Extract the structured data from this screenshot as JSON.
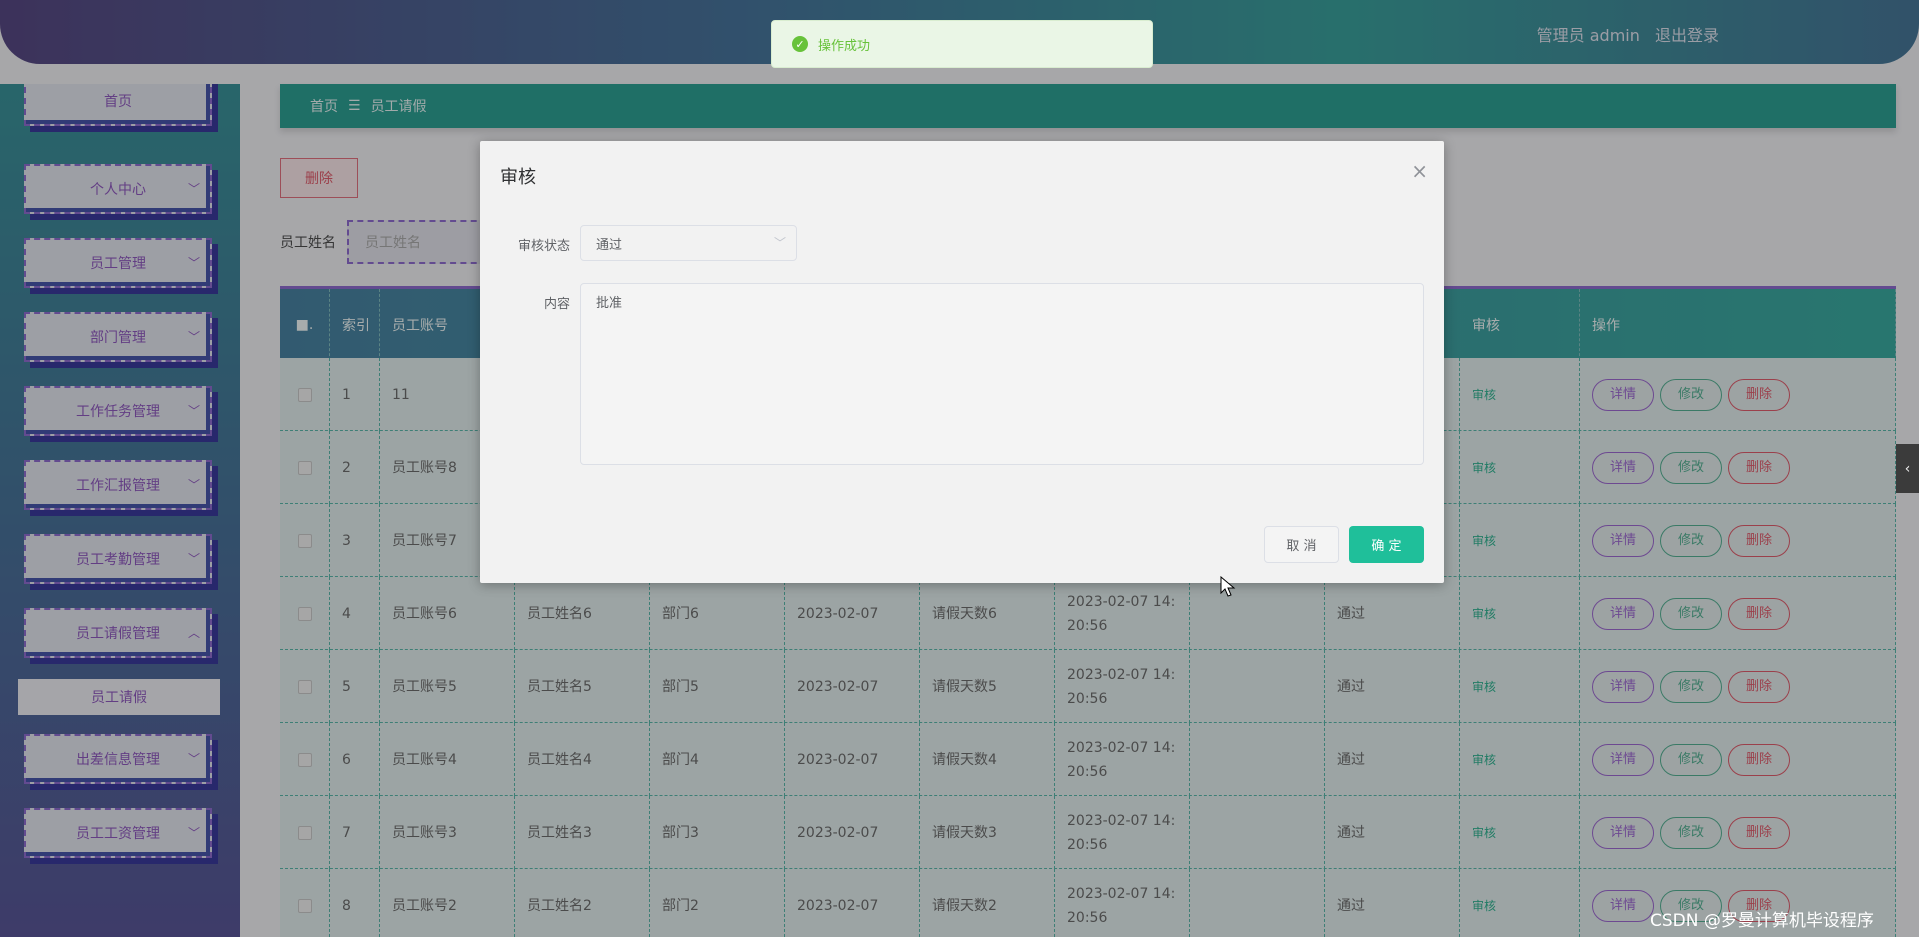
{
  "header": {
    "user_label": "管理员 admin",
    "logout": "退出登录"
  },
  "toast": {
    "message": "操作成功"
  },
  "sidebar": {
    "items": [
      {
        "label": "首页"
      },
      {
        "label": "个人中心"
      },
      {
        "label": "员工管理"
      },
      {
        "label": "部门管理"
      },
      {
        "label": "工作任务管理"
      },
      {
        "label": "工作汇报管理"
      },
      {
        "label": "员工考勤管理"
      },
      {
        "label": "员工请假管理"
      },
      {
        "label": "出差信息管理"
      },
      {
        "label": "员工工资管理"
      }
    ],
    "sub_item": "员工请假"
  },
  "breadcrumb": {
    "home": "首页",
    "separator": "☰",
    "current": "员工请假"
  },
  "toolbar": {
    "delete_label": "删除",
    "search_label": "员工姓名",
    "search_placeholder": "员工姓名"
  },
  "table": {
    "headers": {
      "select": "■.",
      "index": "索引",
      "account": "员工账号",
      "audit": "审核",
      "actions": "操作"
    },
    "rows": [
      {
        "idx": "1",
        "account": "11",
        "name": "",
        "dept": "",
        "date": "",
        "days": "",
        "time": "",
        "status": ""
      },
      {
        "idx": "2",
        "account": "员工账号8",
        "name": "",
        "dept": "",
        "date": "",
        "days": "",
        "time": "",
        "status": ""
      },
      {
        "idx": "3",
        "account": "员工账号7",
        "name": "",
        "dept": "",
        "date": "",
        "days": "",
        "time": "",
        "status": ""
      },
      {
        "idx": "4",
        "account": "员工账号6",
        "name": "员工姓名6",
        "dept": "部门6",
        "date": "2023-02-07",
        "days": "请假天数6",
        "time": "2023-02-07 14:20:56",
        "status": "通过"
      },
      {
        "idx": "5",
        "account": "员工账号5",
        "name": "员工姓名5",
        "dept": "部门5",
        "date": "2023-02-07",
        "days": "请假天数5",
        "time": "2023-02-07 14:20:56",
        "status": "通过"
      },
      {
        "idx": "6",
        "account": "员工账号4",
        "name": "员工姓名4",
        "dept": "部门4",
        "date": "2023-02-07",
        "days": "请假天数4",
        "time": "2023-02-07 14:20:56",
        "status": "通过"
      },
      {
        "idx": "7",
        "account": "员工账号3",
        "name": "员工姓名3",
        "dept": "部门3",
        "date": "2023-02-07",
        "days": "请假天数3",
        "time": "2023-02-07 14:20:56",
        "status": "通过"
      },
      {
        "idx": "8",
        "account": "员工账号2",
        "name": "员工姓名2",
        "dept": "部门2",
        "date": "2023-02-07",
        "days": "请假天数2",
        "time": "2023-02-07 14:20:56",
        "status": "通过"
      }
    ],
    "audit_link": "审核",
    "op_detail": "详情",
    "op_edit": "修改",
    "op_delete": "删除"
  },
  "dialog": {
    "title": "审核",
    "status_label": "审核状态",
    "status_value": "通过",
    "content_label": "内容",
    "content_value": "批准",
    "cancel": "取 消",
    "confirm": "确 定"
  },
  "watermark": "CSDN @罗曼计算机毕设程序",
  "colors": {
    "accent": "#1fbf9a",
    "success": "#67c23a",
    "danger": "#d54355",
    "purple": "#8c52c6"
  }
}
